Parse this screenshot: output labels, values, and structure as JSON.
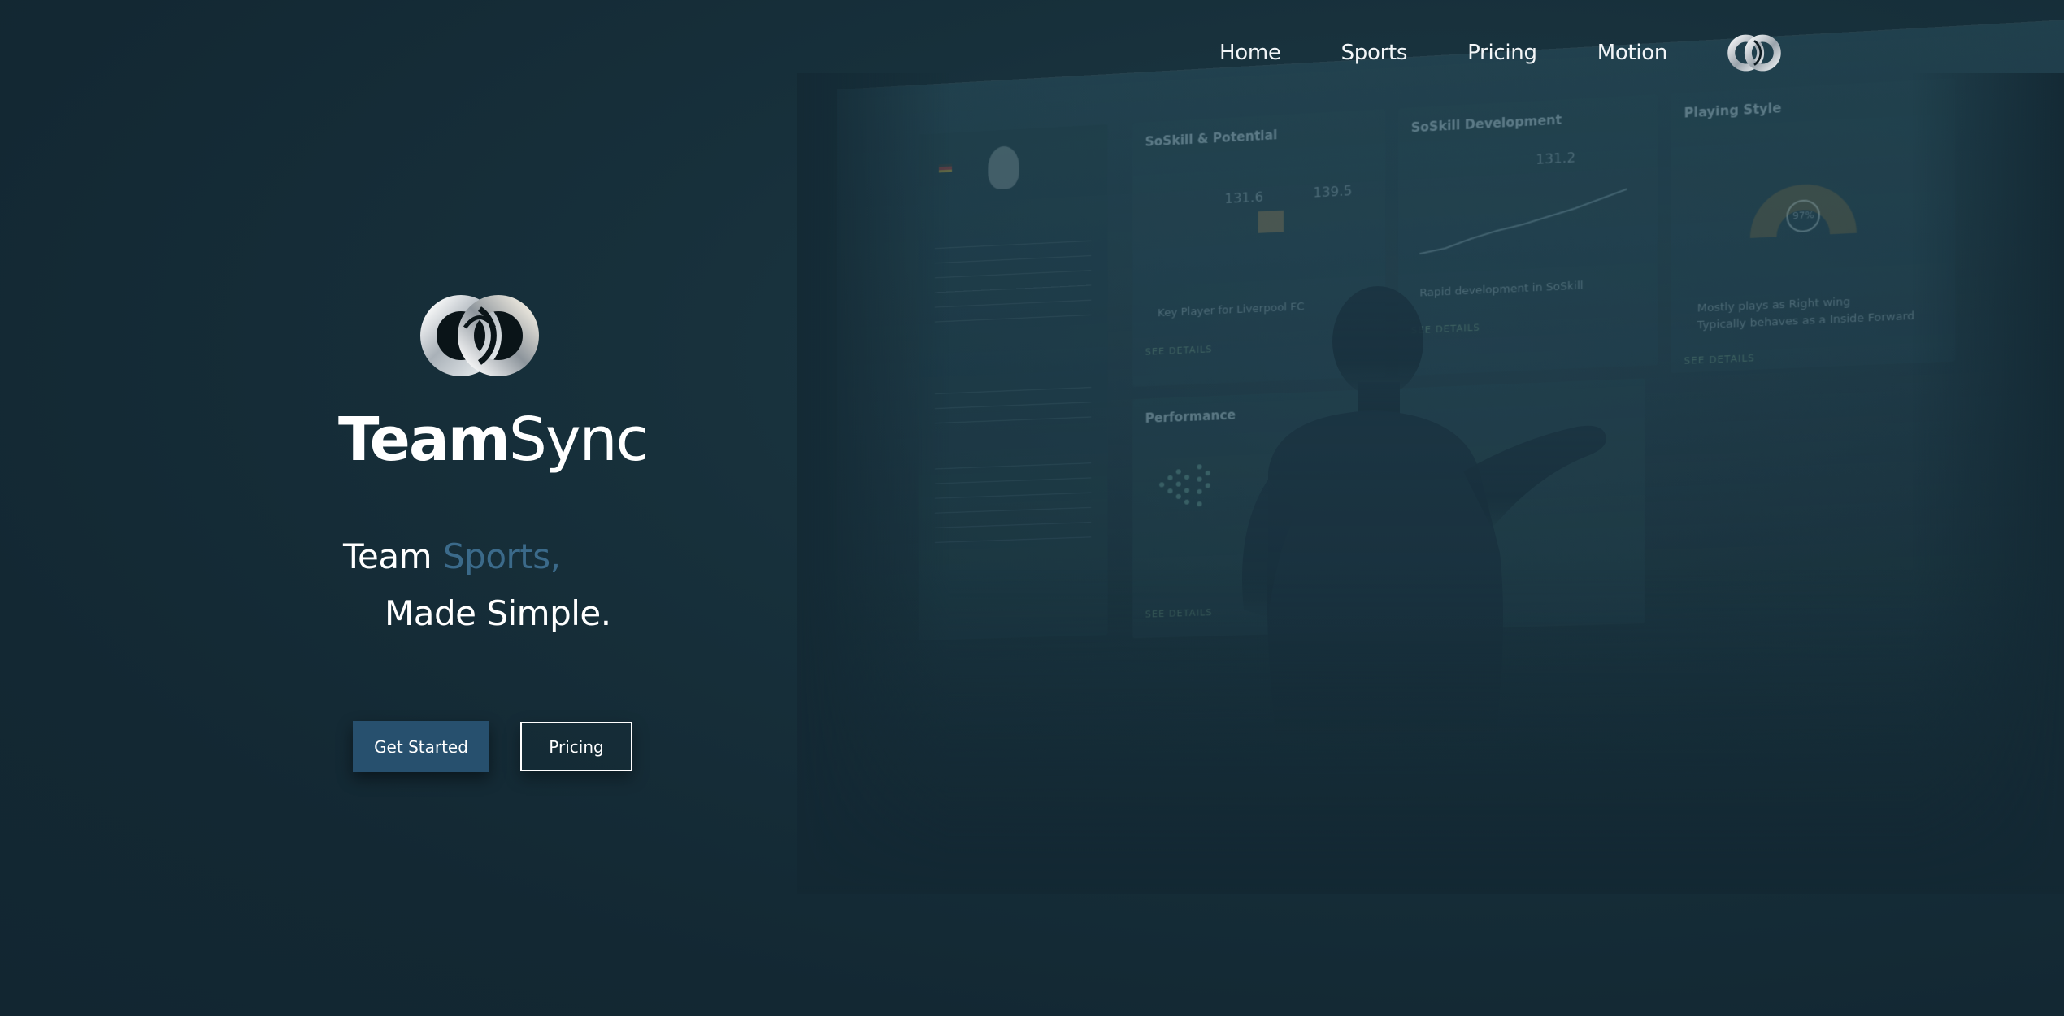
{
  "nav": {
    "items": [
      {
        "label": "Home"
      },
      {
        "label": "Sports"
      },
      {
        "label": "Pricing"
      },
      {
        "label": "Motion"
      }
    ],
    "logo_icon": "teamsync-interlocking-rings-icon"
  },
  "hero": {
    "logo_icon": "teamsync-interlocking-rings-icon",
    "brand_bold": "Team",
    "brand_light": "Sync",
    "tagline_line1_plain": "Team",
    "tagline_line1_accent": "Sports,",
    "tagline_line2": "Made Simple.",
    "primary_button": "Get Started",
    "secondary_button": "Pricing"
  },
  "background_dashboard": {
    "headings": [
      "SoSkill & Potential",
      "SoSkill Development",
      "Playing Style",
      "Performance"
    ],
    "values": [
      "131.6",
      "139.5",
      "131.2",
      "97%"
    ],
    "links": [
      "SEE DETAILS",
      "SEE DETAILS",
      "SEE DETAILS",
      "SEE DETAILS"
    ],
    "notes": [
      "Key Player for Liverpool FC",
      "Rapid development in SoSkill",
      "Mostly plays as Right wing",
      "Typically behaves as a Inside Forward"
    ]
  },
  "colors": {
    "background": "#152a34",
    "accent": "#3b6a8a",
    "primary_button": "#27506e",
    "text": "#ffffff"
  }
}
